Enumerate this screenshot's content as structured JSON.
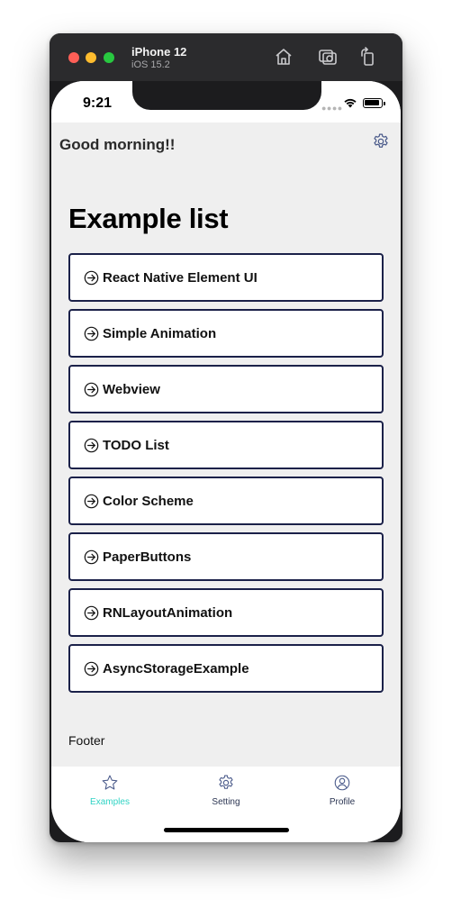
{
  "window": {
    "device_name": "iPhone 12",
    "os_version": "iOS 15.2"
  },
  "status_bar": {
    "time": "9:21"
  },
  "header": {
    "greeting": "Good morning!!"
  },
  "main": {
    "title": "Example list",
    "items": [
      {
        "label": "React Native Element UI"
      },
      {
        "label": "Simple Animation"
      },
      {
        "label": "Webview"
      },
      {
        "label": "TODO List"
      },
      {
        "label": "Color Scheme"
      },
      {
        "label": "PaperButtons"
      },
      {
        "label": "RNLayoutAnimation"
      },
      {
        "label": "AsyncStorageExample"
      }
    ],
    "footer": "Footer"
  },
  "tab_bar": {
    "tabs": [
      {
        "label": "Examples",
        "icon": "star-icon",
        "active": true
      },
      {
        "label": "Setting",
        "icon": "gear-icon",
        "active": false
      },
      {
        "label": "Profile",
        "icon": "user-icon",
        "active": false
      }
    ]
  },
  "colors": {
    "accent_active_tab": "#2fd3c4",
    "inactive_tab_icon": "#4a5a8a",
    "item_border": "#1b2149",
    "content_background": "#efefef"
  }
}
